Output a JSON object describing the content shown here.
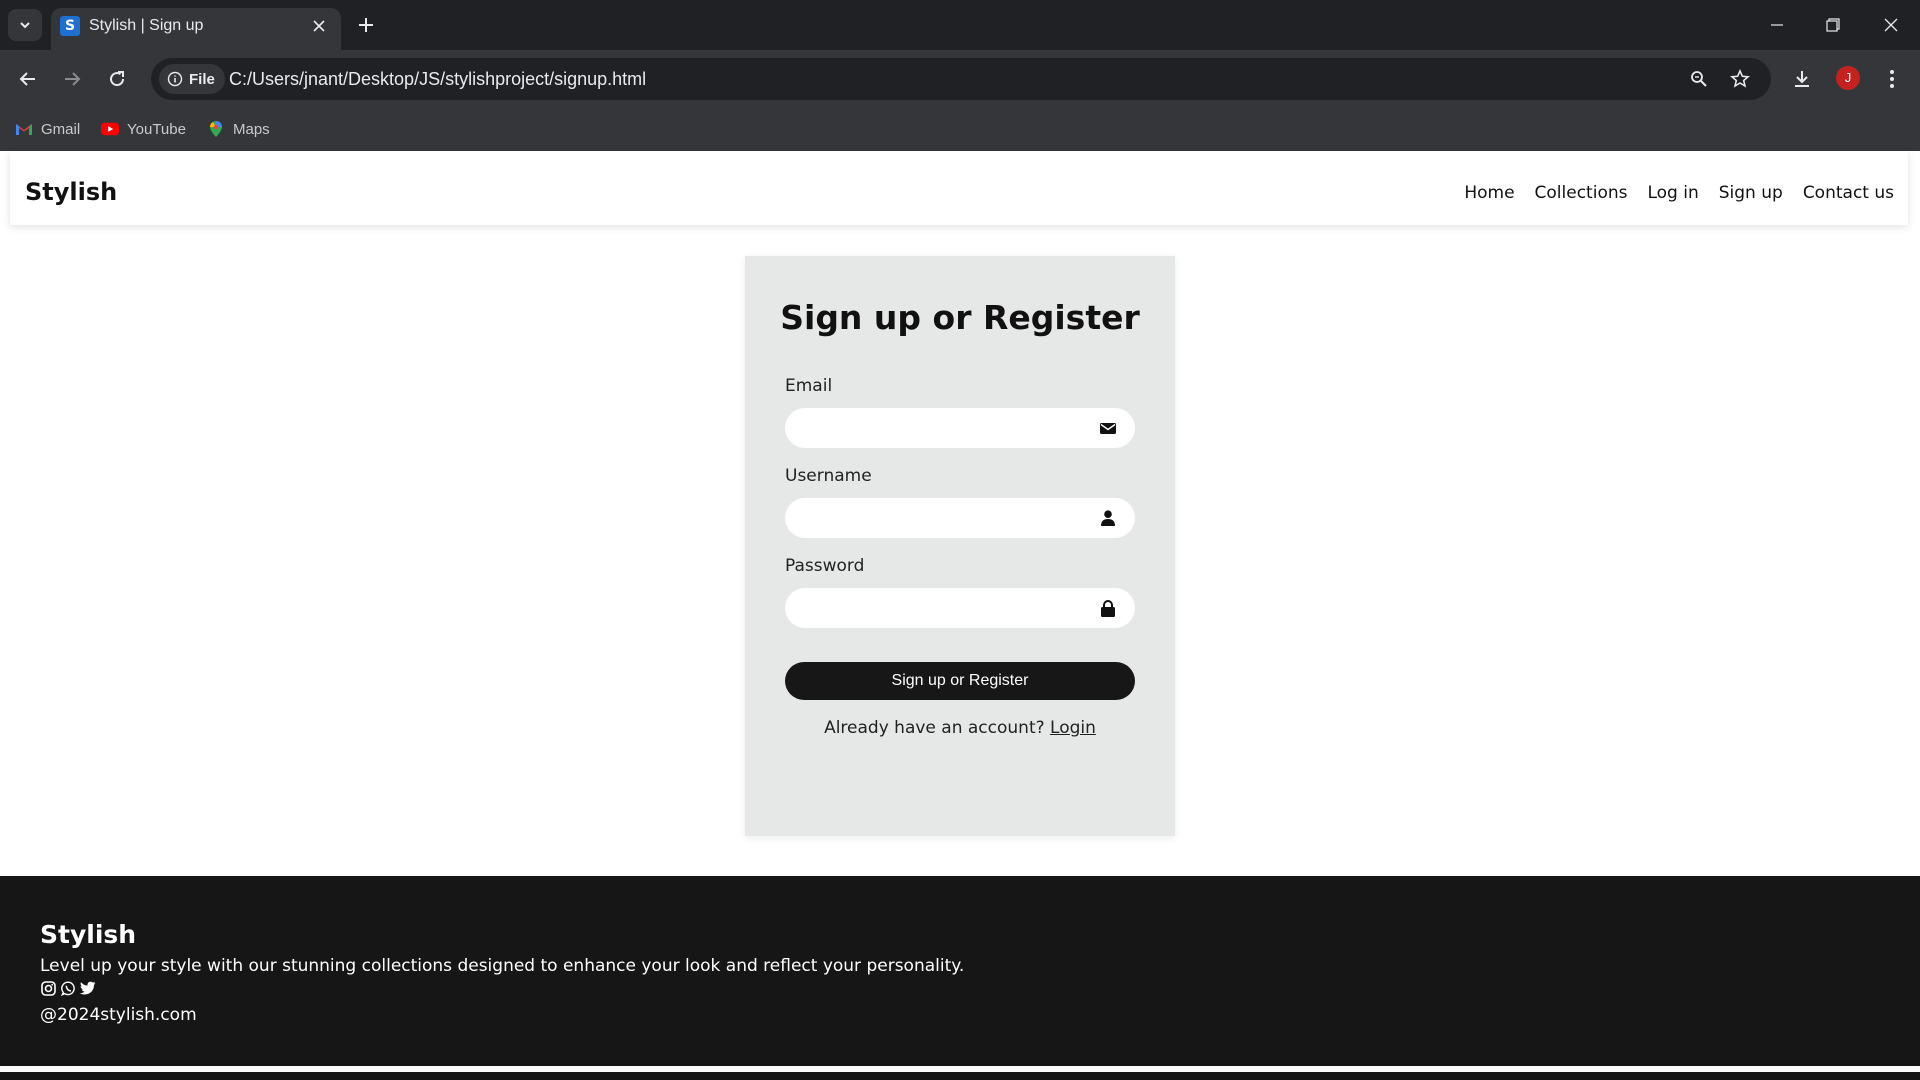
{
  "browser": {
    "tab_title": "Stylish | Sign up",
    "favicon_letter": "S",
    "url_chip": "File",
    "url": "C:/Users/jnant/Desktop/JS/stylishproject/signup.html",
    "profile_initial": "J",
    "bookmarks": [
      {
        "label": "Gmail",
        "icon": "gmail-icon"
      },
      {
        "label": "YouTube",
        "icon": "youtube-icon"
      },
      {
        "label": "Maps",
        "icon": "maps-icon"
      }
    ]
  },
  "site": {
    "brand": "Stylish",
    "nav": [
      "Home",
      "Collections",
      "Log in",
      "Sign up",
      "Contact us"
    ]
  },
  "form": {
    "title": "Sign up or Register",
    "email_label": "Email",
    "email_value": "",
    "username_label": "Username",
    "username_value": "",
    "password_label": "Password",
    "password_value": "",
    "submit_label": "Sign up or Register",
    "login_prompt": "Already have an account?",
    "login_link": "Login"
  },
  "footer": {
    "brand": "Stylish",
    "tagline": "Level up your style with our stunning collections designed to enhance your look and reflect your personality.",
    "social_icons": [
      "instagram-icon",
      "whatsapp-icon",
      "twitter-icon"
    ],
    "copyright": "@2024stylish.com"
  },
  "colors": {
    "chrome_dark": "#202124",
    "chrome_toolbar": "#35363a",
    "card_bg": "#e6e7e7",
    "button_bg": "#171717",
    "footer_bg": "#161616",
    "avatar_bg": "#c5221f"
  }
}
